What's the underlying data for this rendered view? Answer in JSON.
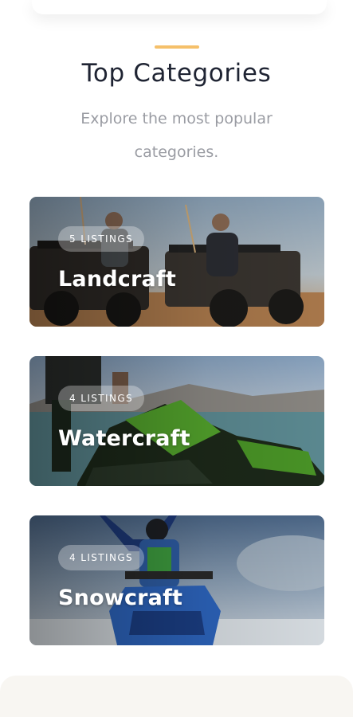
{
  "section": {
    "title": "Top Categories",
    "subtitle": "Explore the most popular categories."
  },
  "categories": [
    {
      "name": "Landcraft",
      "listings": "5 LISTINGS"
    },
    {
      "name": "Watercraft",
      "listings": "4 LISTINGS"
    },
    {
      "name": "Snowcraft",
      "listings": "4 LISTINGS"
    }
  ],
  "colors": {
    "accent": "#f5c06a",
    "title": "#1f2433",
    "subtitle": "#9a9ca3"
  }
}
